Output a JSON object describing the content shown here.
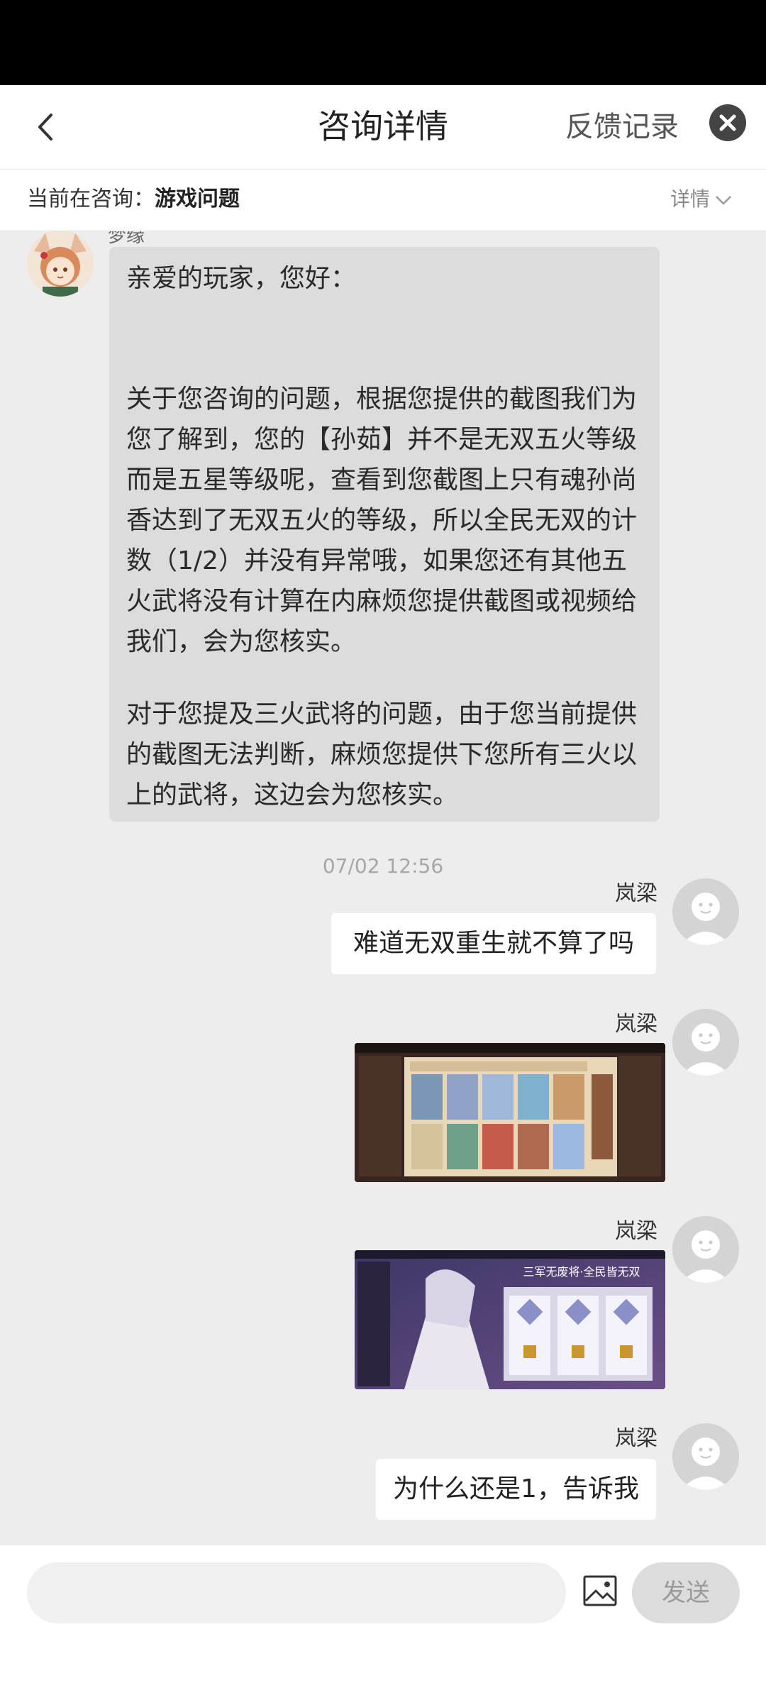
{
  "header": {
    "title": "咨询详情",
    "feedback_link": "反馈记录"
  },
  "subbar": {
    "prefix": "当前在咨询：",
    "topic": "游戏问题",
    "detail_label": "详情"
  },
  "messages": {
    "agent": {
      "greeting": "亲爱的玩家，您好：",
      "paragraph1": "关于您咨询的问题，根据您提供的截图我们为您了解到，您的【孙茹】并不是无双五火等级而是五星等级呢，查看到您截图上只有魂孙尚香达到了无双五火的等级，所以全民无双的计数（1/2）并没有异常哦，如果您还有其他五火武将没有计算在内麻烦您提供截图或视频给我们，会为您核实。",
      "paragraph2": "对于您提及三火武将的问题，由于您当前提供的截图无法判断，麻烦您提供下您所有三火以上的武将，这边会为您核实。"
    },
    "timestamp": "07/02 12:56",
    "user_name": "岚梁",
    "user_msg1": "难道无双重生就不算了吗",
    "user_msg2": "为什么还是1，告诉我",
    "image2_banner": "三军无废将·全民皆无双"
  },
  "input": {
    "placeholder": "",
    "send_label": "发送"
  },
  "icons": {
    "back": "chevron-left-icon",
    "close": "close-icon",
    "detail": "chevron-down-icon",
    "image": "image-icon",
    "avatar_default": "smiley-avatar-icon"
  },
  "colors": {
    "background": "#ededed",
    "agent_bubble": "#dcdcdc",
    "user_bubble": "#ffffff",
    "send_disabled": "#dcdcdc"
  }
}
